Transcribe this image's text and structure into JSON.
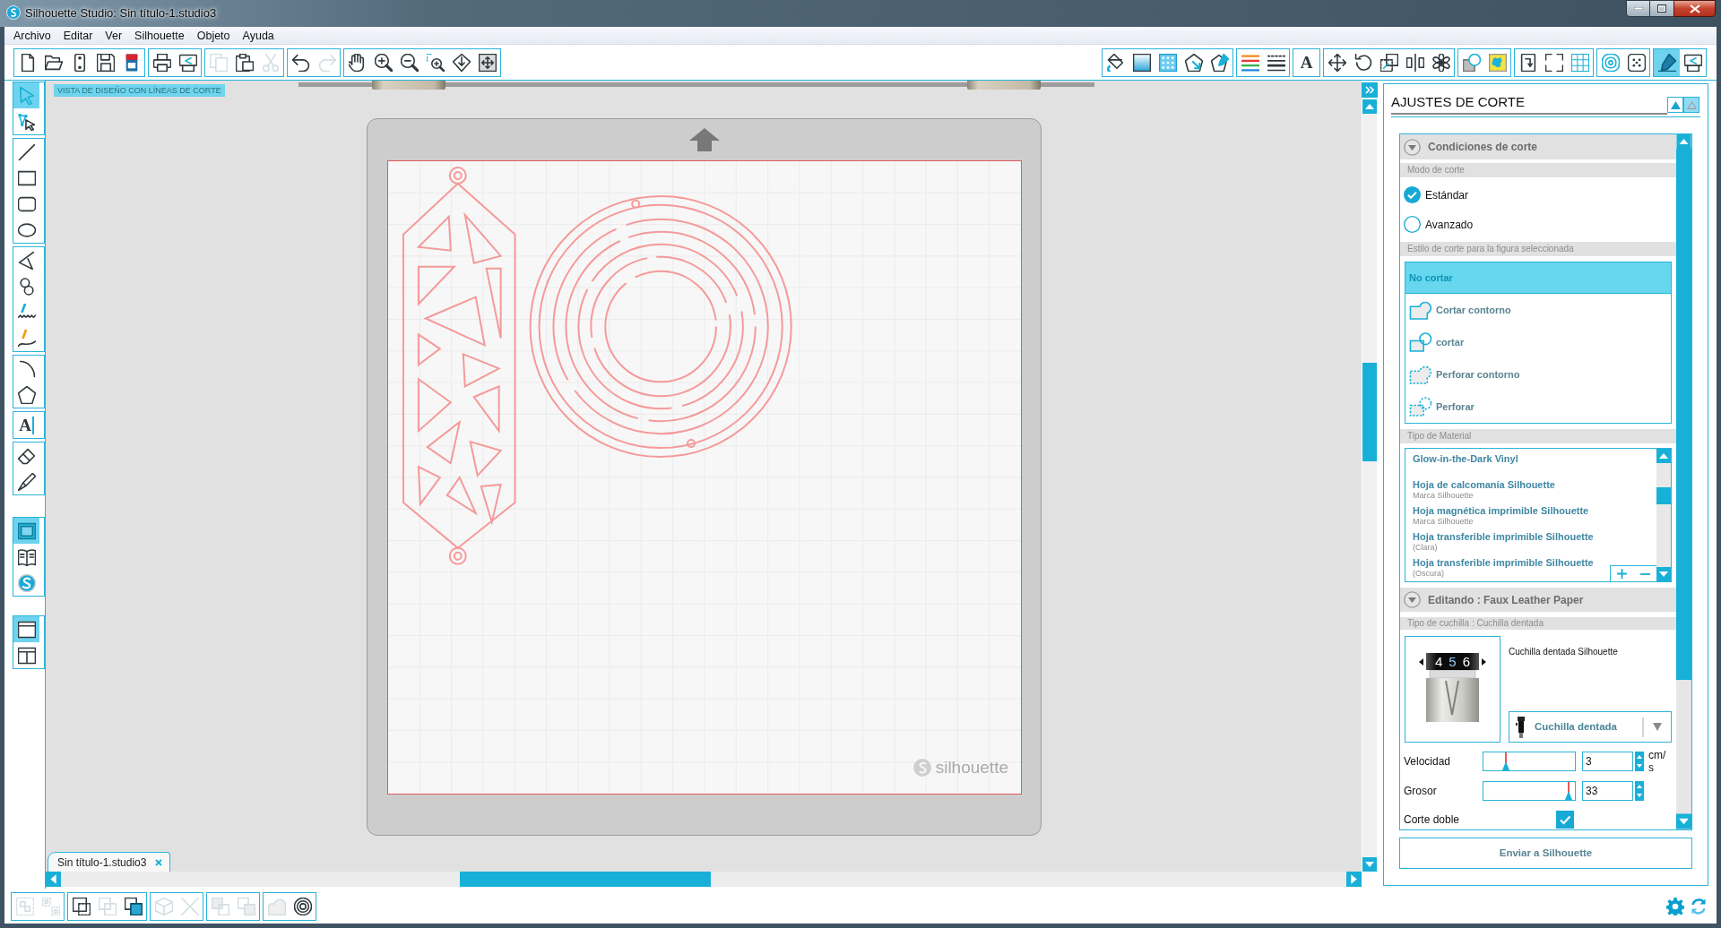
{
  "window": {
    "title": "Silhouette Studio: Sin título-1.studio3"
  },
  "menu": [
    "Archivo",
    "Editar",
    "Ver",
    "Silhouette",
    "Objeto",
    "Ayuda"
  ],
  "toolbar": {
    "left": [
      [
        {
          "kind": "new",
          "disabled": false
        },
        {
          "kind": "open",
          "disabled": false
        },
        {
          "kind": "template",
          "disabled": false
        },
        {
          "kind": "save",
          "disabled": false
        },
        {
          "kind": "library",
          "disabled": false
        }
      ],
      [
        {
          "kind": "print",
          "disabled": false
        },
        {
          "kind": "send",
          "disabled": false
        }
      ],
      [
        {
          "kind": "copy",
          "disabled": true
        },
        {
          "kind": "paste",
          "disabled": false
        },
        {
          "kind": "cut",
          "disabled": true
        }
      ],
      [
        {
          "kind": "undo",
          "disabled": false
        },
        {
          "kind": "redo",
          "disabled": true
        }
      ],
      [
        {
          "kind": "pan",
          "disabled": false
        },
        {
          "kind": "zoom_in",
          "disabled": false
        },
        {
          "kind": "zoom_out",
          "disabled": false
        },
        {
          "kind": "zoom_select",
          "disabled": false
        },
        {
          "kind": "zoom_drag",
          "disabled": false
        },
        {
          "kind": "fit",
          "disabled": false
        }
      ]
    ],
    "right": [
      [
        {
          "kind": "fill",
          "selected": false
        },
        {
          "kind": "gradient",
          "selected": false
        },
        {
          "kind": "pattern",
          "selected": false
        },
        {
          "kind": "shadow",
          "selected": false
        },
        {
          "kind": "line_pen",
          "selected": false
        }
      ],
      [
        {
          "kind": "line_color",
          "selected": false
        },
        {
          "kind": "line_style",
          "selected": false
        }
      ],
      [
        {
          "kind": "text",
          "selected": false,
          "glyph": "A"
        }
      ],
      [
        {
          "kind": "move",
          "selected": false
        },
        {
          "kind": "rotate",
          "selected": false
        },
        {
          "kind": "scale",
          "selected": false
        },
        {
          "kind": "align",
          "selected": false
        },
        {
          "kind": "replicate",
          "selected": false
        }
      ],
      [
        {
          "kind": "modify",
          "selected": false
        },
        {
          "kind": "trace",
          "selected": false
        }
      ],
      [
        {
          "kind": "page",
          "selected": false
        },
        {
          "kind": "regmarks",
          "selected": false
        },
        {
          "kind": "grid",
          "selected": false
        }
      ],
      [
        {
          "kind": "offset",
          "selected": false
        },
        {
          "kind": "sketch",
          "selected": false
        }
      ],
      [
        {
          "kind": "blade",
          "selected": true
        },
        {
          "kind": "send",
          "selected": false
        }
      ]
    ]
  },
  "tools": {
    "groups": [
      [
        {
          "kind": "select",
          "selected": true
        },
        {
          "kind": "node",
          "selected": false
        }
      ],
      [
        {
          "kind": "line",
          "selected": false
        },
        {
          "kind": "rect",
          "selected": false
        },
        {
          "kind": "rrect",
          "selected": false
        },
        {
          "kind": "ellipse",
          "selected": false
        }
      ],
      [
        {
          "kind": "polygon",
          "selected": false
        },
        {
          "kind": "curve",
          "selected": false
        },
        {
          "kind": "freehand",
          "selected": false
        },
        {
          "kind": "smooth",
          "selected": false
        }
      ],
      [
        {
          "kind": "arc",
          "selected": false
        },
        {
          "kind": "regpoly",
          "selected": false
        }
      ],
      [
        {
          "kind": "text",
          "selected": false,
          "glyph": "A"
        }
      ],
      [
        {
          "kind": "eraser",
          "selected": false
        },
        {
          "kind": "knife",
          "selected": false
        }
      ]
    ],
    "views": [
      {
        "kind": "design",
        "selected": true
      },
      {
        "kind": "library_view",
        "selected": false
      },
      {
        "kind": "store",
        "selected": false
      }
    ],
    "windows": [
      {
        "kind": "single",
        "selected": true
      },
      {
        "kind": "split",
        "selected": false
      }
    ]
  },
  "canvas": {
    "view_label": "VISTA DE DISEÑO CON LÍNEAS DE CORTE",
    "mat_logo": "silhouette",
    "document_tab": "Sin título-1.studio3"
  },
  "cut_settings": {
    "title": "AJUSTES DE CORTE",
    "conditions": {
      "header": "Condiciones de corte",
      "expanded": true
    },
    "mode_label": "Modo de corte",
    "modes": [
      {
        "label": "Estándar",
        "selected": true
      },
      {
        "label": "Avanzado",
        "selected": false
      }
    ],
    "style_label": "Estilo de corte para la figura seleccionada",
    "styles": [
      {
        "kind": "none",
        "label": "No cortar",
        "selected": true
      },
      {
        "kind": "cut_edge",
        "label": "Cortar contorno",
        "selected": false
      },
      {
        "kind": "cut",
        "label": "cortar",
        "selected": false
      },
      {
        "kind": "perforate_edge",
        "label": "Perforar contorno",
        "selected": false
      },
      {
        "kind": "perforate",
        "label": "Perforar",
        "selected": false
      }
    ],
    "material_label": "Tipo de Material",
    "materials": [
      {
        "name": "Glow-in-the-Dark Vinyl"
      },
      {
        "name": "Hoja de calcomanía Silhouette",
        "note": "Marca Silhouette"
      },
      {
        "name": "Hoja magnética imprimible Silhouette",
        "note": "Marca Silhouette"
      },
      {
        "name": "Hoja transferible imprimible Silhouette",
        "note": "(Clara)"
      },
      {
        "name": "Hoja transferible imprimible Silhouette",
        "note": "(Oscura)"
      }
    ],
    "editing": {
      "header": "Editando : Faux Leather Paper",
      "expanded": true
    },
    "blade_label": "Tipo de cuchilla : Cuchilla dentada",
    "blade_dial": [
      {
        "label": "4",
        "selected": false
      },
      {
        "label": "5",
        "selected": true
      },
      {
        "label": "6",
        "selected": false
      }
    ],
    "blade_name": "Cuchilla dentada Silhouette",
    "blade_dropdown": "Cuchilla dentada",
    "speed": {
      "label": "Velocidad",
      "level": 0.22,
      "value": "3",
      "unit": "cm/s"
    },
    "thickness": {
      "label": "Grosor",
      "level": 0.97,
      "value": "33"
    },
    "double_cut": {
      "label": "Corte doble",
      "checked": true
    },
    "send_button": "Enviar a Silhouette"
  },
  "status_toolbar": [
    [
      {
        "kind": "group",
        "disabled": true
      },
      {
        "kind": "ungroup",
        "disabled": true
      }
    ],
    [
      {
        "kind": "compound",
        "disabled": false
      },
      {
        "kind": "release",
        "disabled": true
      },
      {
        "kind": "front",
        "disabled": false
      }
    ],
    [
      {
        "kind": "cube",
        "disabled": true
      },
      {
        "kind": "cross",
        "disabled": true
      }
    ],
    [
      {
        "kind": "backward",
        "disabled": true
      },
      {
        "kind": "forward",
        "disabled": true
      }
    ],
    [
      {
        "kind": "shape",
        "disabled": true
      },
      {
        "kind": "rings",
        "disabled": false
      }
    ]
  ]
}
